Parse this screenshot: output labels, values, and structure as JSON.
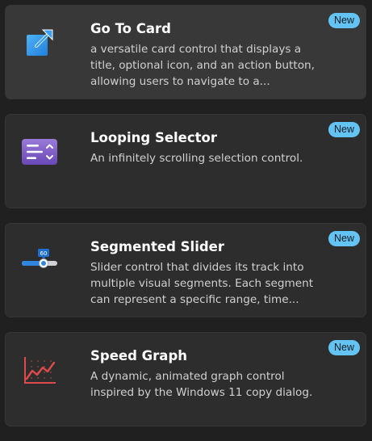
{
  "cards": [
    {
      "title": "Go To Card",
      "description": "a versatile card control that displays a title, optional icon, and an action button, allowing users to navigate to a...",
      "badge": "New",
      "icon": "go-to-card-icon"
    },
    {
      "title": "Looping Selector",
      "description": "An infinitely scrolling selection control.",
      "badge": "New",
      "icon": "looping-selector-icon"
    },
    {
      "title": "Segmented Slider",
      "description": "Slider control that divides its track into multiple visual segments. Each segment can represent a specific range, time...",
      "badge": "New",
      "icon": "segmented-slider-icon",
      "icon_value": "60"
    },
    {
      "title": "Speed Graph",
      "description": "A dynamic, animated graph control inspired by the Windows 11 copy dialog.",
      "badge": "New",
      "icon": "speed-graph-icon"
    }
  ],
  "colors": {
    "badge": "#63c4f4",
    "card": "#2d2d2d",
    "background": "#202020",
    "go_to_icon": "#2f9af0",
    "looping_icon": "#7b5cc4",
    "slider_icon": "#2f86e0",
    "graph_icon": "#e04a4a"
  }
}
